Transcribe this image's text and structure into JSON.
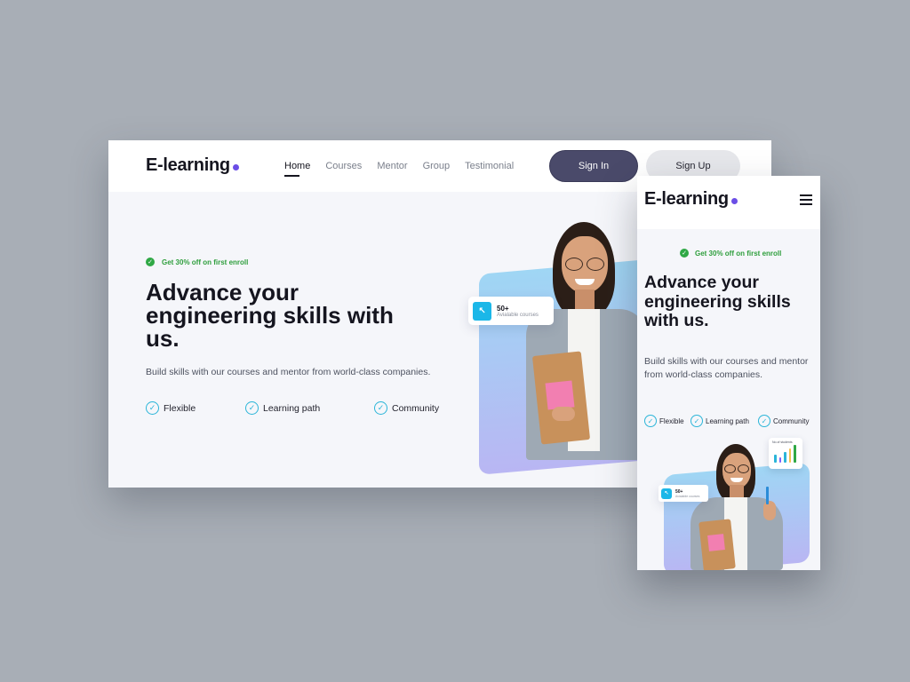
{
  "brand": {
    "name": "E-learning",
    "accent": "#6b4ee6"
  },
  "nav": {
    "items": [
      {
        "label": "Home",
        "active": true
      },
      {
        "label": "Courses",
        "active": false
      },
      {
        "label": "Mentor",
        "active": false
      },
      {
        "label": "Group",
        "active": false
      },
      {
        "label": "Testimonial",
        "active": false
      }
    ],
    "sign_in": "Sign In",
    "sign_up": "Sign Up"
  },
  "hero": {
    "promo": "Get 30% off on first enroll",
    "heading": "Advance your engineering skills with us.",
    "subtext": "Build skills with our courses and mentor from world-class companies.",
    "features": [
      "Flexible",
      "Learning path",
      "Community"
    ]
  },
  "stat_card": {
    "value": "50+",
    "label": "Avialable courses"
  },
  "mobile": {
    "menu_icon": "hamburger-menu-icon",
    "chart_card": {
      "label": "No.of students",
      "bars": [
        {
          "level": 0.45,
          "color": "#2bb5d8"
        },
        {
          "level": 0.3,
          "color": "#7b61ff"
        },
        {
          "level": 0.6,
          "color": "#2bb5d8"
        },
        {
          "level": 0.8,
          "color": "#f2c14e"
        },
        {
          "level": 1.0,
          "color": "#2fa845"
        }
      ]
    }
  },
  "colors": {
    "sign_in_bg": "#4a4a6a",
    "promo_green": "#2fa845",
    "check_teal": "#2bb5d8",
    "stat_icon_bg": "#1bb7e8"
  }
}
